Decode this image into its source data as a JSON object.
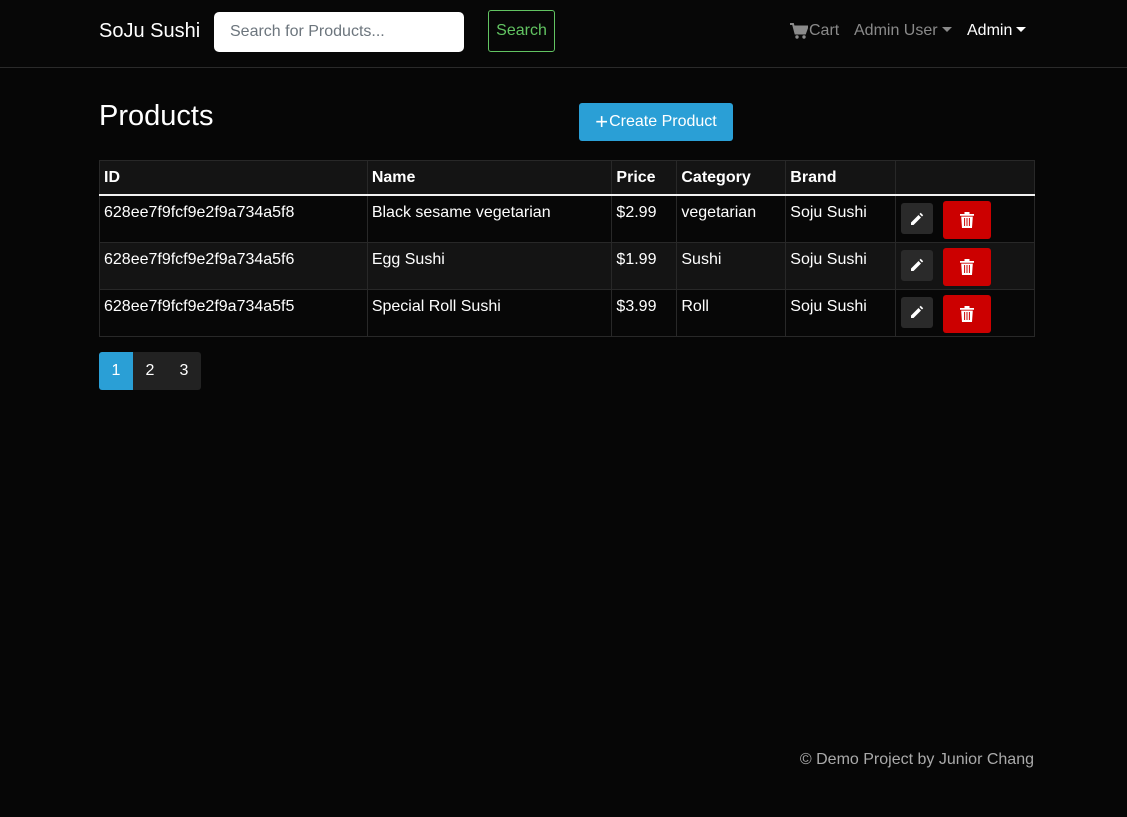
{
  "navbar": {
    "brand": "SoJu Sushi",
    "search_placeholder": "Search for Products...",
    "search_button": "Search",
    "cart_label": "Cart",
    "user_menu": "Admin User",
    "admin_menu": "Admin"
  },
  "main": {
    "title": "Products",
    "create_button": "Create Product",
    "table": {
      "headers": [
        "ID",
        "Name",
        "Price",
        "Category",
        "Brand",
        ""
      ],
      "rows": [
        {
          "id": "628ee7f9fcf9e2f9a734a5f8",
          "name": "Black sesame vegetarian",
          "price": "$2.99",
          "category": "vegetarian",
          "brand": "Soju Sushi"
        },
        {
          "id": "628ee7f9fcf9e2f9a734a5f6",
          "name": "Egg Sushi",
          "price": "$1.99",
          "category": "Sushi",
          "brand": "Soju Sushi"
        },
        {
          "id": "628ee7f9fcf9e2f9a734a5f5",
          "name": "Special Roll Sushi",
          "price": "$3.99",
          "category": "Roll",
          "brand": "Soju Sushi"
        }
      ]
    },
    "pagination": [
      "1",
      "2",
      "3"
    ],
    "active_page": "1"
  },
  "footer": {
    "text": "© Demo Project by Junior Chang"
  },
  "icons": {
    "cart": "cart-icon",
    "plus": "plus-icon",
    "edit": "pencil-icon",
    "delete": "trash-icon"
  },
  "colors": {
    "accent": "#2a9fd6",
    "danger": "#cc0000",
    "success": "#62c462",
    "background": "#060606"
  }
}
